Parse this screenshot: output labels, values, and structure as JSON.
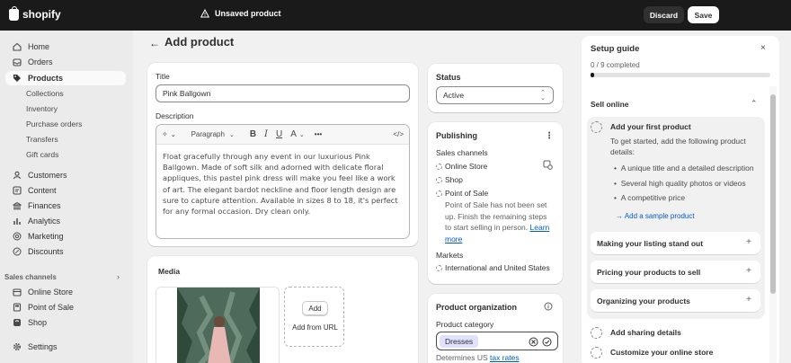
{
  "topbar": {
    "brand": "shopify",
    "unsaved_label": "Unsaved product",
    "discard_label": "Discard",
    "save_label": "Save"
  },
  "sidebar": {
    "items": [
      {
        "label": "Home",
        "icon": "home-icon"
      },
      {
        "label": "Orders",
        "icon": "inbox-icon"
      },
      {
        "label": "Products",
        "icon": "tag-icon"
      },
      {
        "label": "Customers",
        "icon": "person-icon"
      },
      {
        "label": "Content",
        "icon": "content-icon"
      },
      {
        "label": "Finances",
        "icon": "bank-icon"
      },
      {
        "label": "Analytics",
        "icon": "chart-icon"
      },
      {
        "label": "Marketing",
        "icon": "target-icon"
      },
      {
        "label": "Discounts",
        "icon": "discount-icon"
      }
    ],
    "product_sub_items": [
      "Collections",
      "Inventory",
      "Purchase orders",
      "Transfers",
      "Gift cards"
    ],
    "sales_channels_label": "Sales channels",
    "channels": [
      {
        "label": "Online Store",
        "icon": "store-icon"
      },
      {
        "label": "Point of Sale",
        "icon": "pos-icon"
      },
      {
        "label": "Shop",
        "icon": "shop-icon"
      }
    ],
    "settings_label": "Settings"
  },
  "header": {
    "title": "Add product"
  },
  "product_form": {
    "title_label": "Title",
    "title_value": "Pink Ballgown",
    "description_label": "Description",
    "toolbar": {
      "paragraph_label": "Paragraph",
      "bold": "B",
      "italic": "I",
      "underline": "U",
      "text_color": "A",
      "more": "•••",
      "code": "</>"
    },
    "description_text": "Float gracefully through any event in our luxurious Pink Ballgown. Made of soft silk and adorned with delicate floral appliques, this pastel pink dress will make you feel like a work of art. The elegant bardot neckline and floor length design are sure to capture attention. Available in sizes 8 to 18, it's perfect for any formal occasion. Dry clean only."
  },
  "media": {
    "title": "Media",
    "add_label": "Add",
    "add_from_url_label": "Add from URL"
  },
  "status": {
    "title": "Status",
    "value": "Active"
  },
  "publishing": {
    "title": "Publishing",
    "sales_channels_label": "Sales channels",
    "channels": [
      "Online Store",
      "Shop",
      "Point of Sale"
    ],
    "pos_note": "Point of Sale has not been set up. Finish the remaining steps to start selling in person.",
    "learn_more": "Learn more",
    "markets_label": "Markets",
    "markets_value": "International and United States"
  },
  "organization": {
    "title": "Product organization",
    "category_label": "Product category",
    "category_value": "Dresses",
    "determines_text": "Determines US",
    "tax_rates_link": "tax rates"
  },
  "setup_guide": {
    "title": "Setup guide",
    "progress_text": "0 / 9 completed",
    "progress_fraction": 0,
    "section_title": "Sell online",
    "task_title": "Add your first product",
    "task_desc": "To get started, add the following product details:",
    "bullets": [
      "A unique title and a detailed description",
      "Several high quality photos or videos",
      "A competitive price"
    ],
    "sample_link": "Add a sample product",
    "subtasks": [
      "Making your listing stand out",
      "Pricing your products to sell",
      "Organizing your products"
    ],
    "other_tasks": [
      "Add sharing details",
      "Customize your online store"
    ]
  }
}
